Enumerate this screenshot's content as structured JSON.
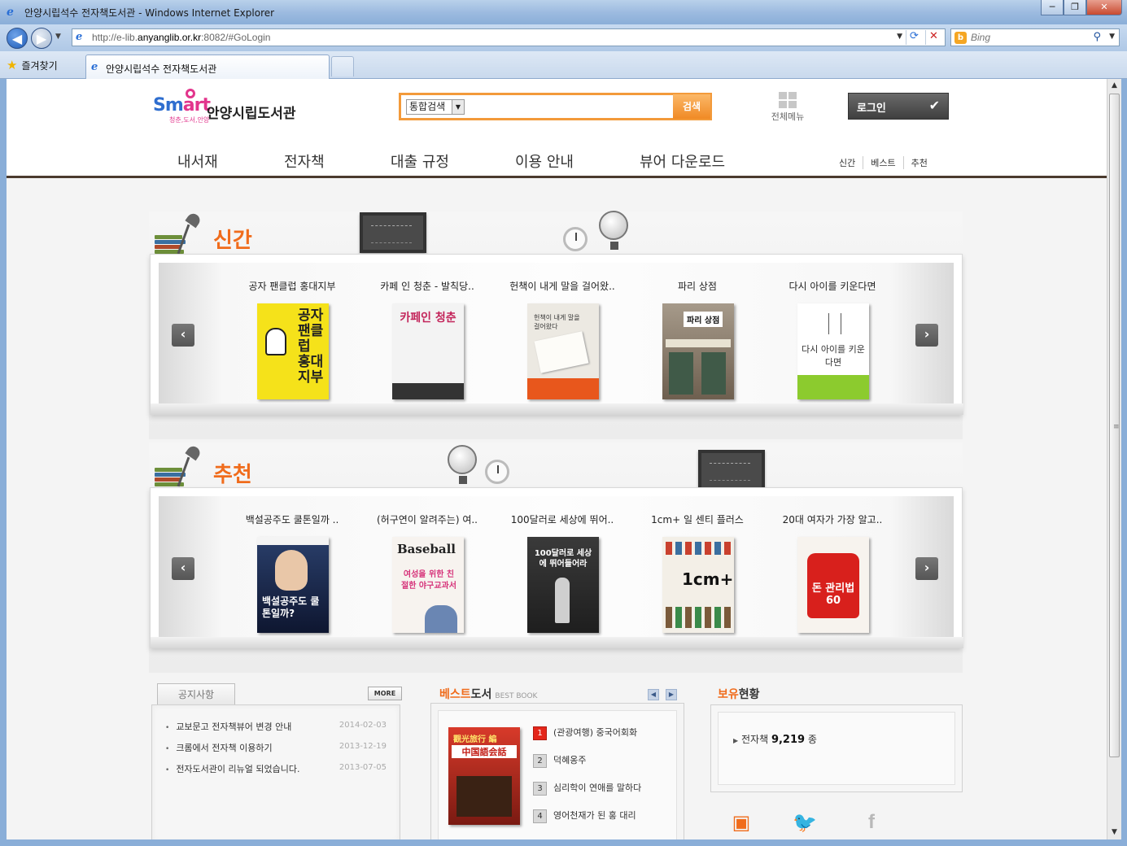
{
  "browser": {
    "window_title": "안양시립석수 전자책도서관 - Windows Internet Explorer",
    "url_prefix": "http://e-lib.",
    "url_domain": "anyanglib.or.kr",
    "url_suffix": ":8082/#GoLogin",
    "search_placeholder": "Bing",
    "favorites_label": "즐겨찾기",
    "tab_label": "안양시립석수 전자책도서관",
    "window_buttons": [
      "─",
      "❐",
      "✕"
    ]
  },
  "header": {
    "logo_text_a": "Sm",
    "logo_text_b": "art",
    "logo_sub": "청춘,도서,안양",
    "library_name": "안양시립도서관",
    "search_select": "통합검색",
    "search_button": "검색",
    "all_menu": "전체메뉴",
    "login": "로그인"
  },
  "gnb": [
    "내서재",
    "전자책",
    "대출 규정",
    "이용 안내",
    "뷰어 다운로드"
  ],
  "subnav": [
    "신간",
    "베스트",
    "추천"
  ],
  "shelves": [
    {
      "title": "신간",
      "books": [
        {
          "title": "공자 팬클럽 홍대지부",
          "cover_text": "공자 팬클럽 홍대지부",
          "color": "#f5e21a"
        },
        {
          "title": "카페 인 청춘 - 발칙당..",
          "cover_text": "카페인 청춘",
          "color": "#f3f3f3"
        },
        {
          "title": "헌책이 내게 말을 걸어왔..",
          "cover_text": "헌책이 내게 말을 걸어왔다",
          "color": "#ece9e2"
        },
        {
          "title": "파리 상점",
          "cover_text": "파리 상점",
          "color": "#8a7a68"
        },
        {
          "title": "다시 아이를 키운다면",
          "cover_text": "다시 아이를 키운다면",
          "color": "#ffffff"
        }
      ]
    },
    {
      "title": "추천",
      "books": [
        {
          "title": "백설공주도 쿨톤일까 ..",
          "cover_text": "백설공주도 쿨톤일까?",
          "color": "#1c2b52"
        },
        {
          "title": "(허구연이 알려주는) 여..",
          "cover_text": "Baseball",
          "color": "#f7f3ef"
        },
        {
          "title": "100달러로 세상에 뛰어..",
          "cover_text": "100달러로 세상에 뛰어들어라",
          "color": "#2e2e2e"
        },
        {
          "title": "1cm+ 일 센티 플러스",
          "cover_text": "1cm+",
          "color": "#f3efe7"
        },
        {
          "title": "20대 여자가 가장 알고..",
          "cover_text": "돈 관리법 60",
          "color": "#f7f3ee"
        }
      ]
    }
  ],
  "notice": {
    "tab_label": "공지사항",
    "more_label": "MORE",
    "items": [
      {
        "text": "교보문고 전자책뷰어 변경 안내",
        "date": "2014-02-03"
      },
      {
        "text": "크롬에서 전자책 이용하기",
        "date": "2013-12-19"
      },
      {
        "text": "전자도서관이 리뉴얼 되었습니다.",
        "date": "2013-07-05"
      }
    ]
  },
  "best": {
    "title_a": "베스트",
    "title_b": "도서",
    "title_en": "BEST BOOK",
    "cover_a": "觀光旅行 編",
    "cover_b": "中国語会話",
    "items": [
      {
        "rank": "1",
        "text": "(관광여행) 중국어회화"
      },
      {
        "rank": "2",
        "text": "덕혜옹주"
      },
      {
        "rank": "3",
        "text": "심리학이 연애를 말하다"
      },
      {
        "rank": "4",
        "text": "영어천재가 된 홍 대리"
      }
    ]
  },
  "holdings": {
    "title_a": "보유",
    "title_b": "현황",
    "label": "전자책",
    "count": "9,219",
    "unit": "종"
  },
  "colors": {
    "accent": "#f06c1c",
    "search_border": "#f39a3a",
    "header_rule": "#4a3a2e"
  }
}
